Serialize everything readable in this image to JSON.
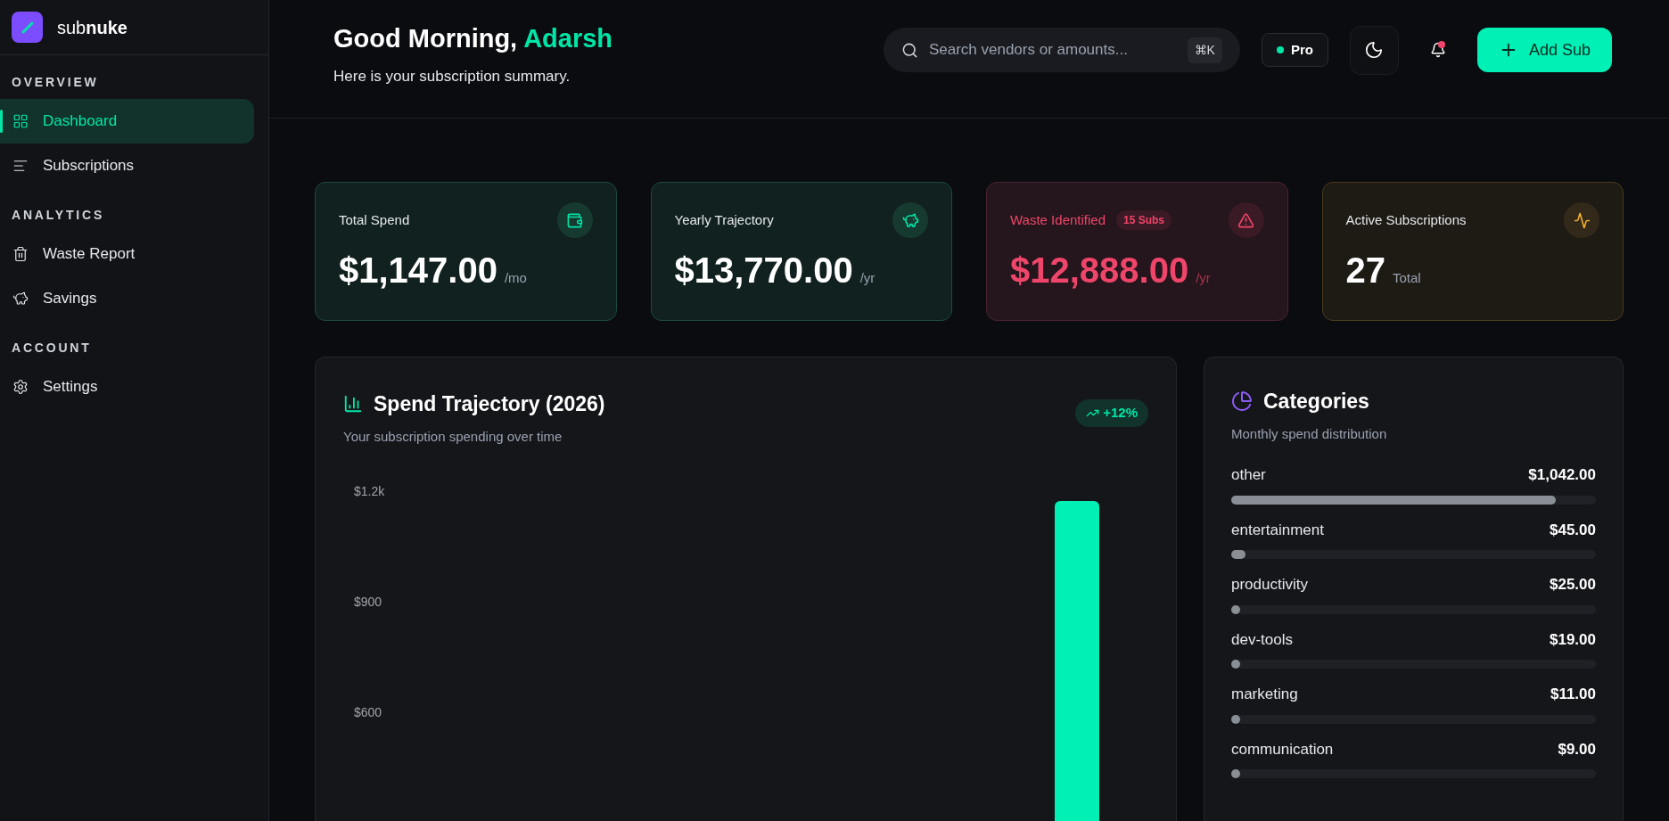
{
  "sidebar": {
    "logo_text": {
      "regular": "sub",
      "bold": "nuke"
    },
    "sections": [
      {
        "title": "OVERVIEW",
        "items": [
          {
            "label": "Dashboard",
            "selected": true
          },
          {
            "label": "Subscriptions",
            "selected": false
          }
        ]
      },
      {
        "title": "ANALYTICS",
        "items": [
          {
            "label": "Waste Report",
            "selected": false
          },
          {
            "label": "Savings",
            "selected": false
          }
        ]
      },
      {
        "title": "ACCOUNT",
        "items": [
          {
            "label": "Settings",
            "selected": false
          }
        ]
      }
    ]
  },
  "header": {
    "greeting": "Good Morning,",
    "name": "Adarsh",
    "subtitle": "Here is your subscription summary.",
    "search": {
      "placeholder": "Search vendors or amounts...",
      "shortcut": "⌘K"
    },
    "plan_badge": "Pro",
    "notifications_unread": true,
    "add_button": "Add Sub"
  },
  "stat_cards": [
    {
      "kind": "green",
      "title": "Total Spend",
      "value": "$1,147.00",
      "unit": "/mo"
    },
    {
      "kind": "green",
      "title": "Yearly Trajectory",
      "value": "$13,770.00",
      "unit": "/yr"
    },
    {
      "kind": "red",
      "title": "Waste Identified",
      "badge": "15 Subs",
      "value": "$12,888.00",
      "unit": "/yr"
    },
    {
      "kind": "amber",
      "title": "Active Subscriptions",
      "value": "27",
      "unit": "Total"
    }
  ],
  "trajectory": {
    "title": "Spend Trajectory (2026)",
    "subtitle": "Your subscription spending over time",
    "trend": "+12%",
    "y_axis_labels": [
      "$1.2k",
      "$900",
      "$600"
    ]
  },
  "categories": {
    "title": "Categories",
    "subtitle": "Monthly spend distribution",
    "items": [
      {
        "name": "other",
        "amount": "$1,042.00",
        "level": 0.89
      },
      {
        "name": "entertainment",
        "amount": "$45.00",
        "level": 0.04
      },
      {
        "name": "productivity",
        "amount": "$25.00",
        "level": 0.02
      },
      {
        "name": "dev-tools",
        "amount": "$19.00",
        "level": 0.02
      },
      {
        "name": "marketing",
        "amount": "$11.00",
        "level": 0.02
      },
      {
        "name": "communication",
        "amount": "$9.00",
        "level": 0.01
      }
    ]
  }
}
